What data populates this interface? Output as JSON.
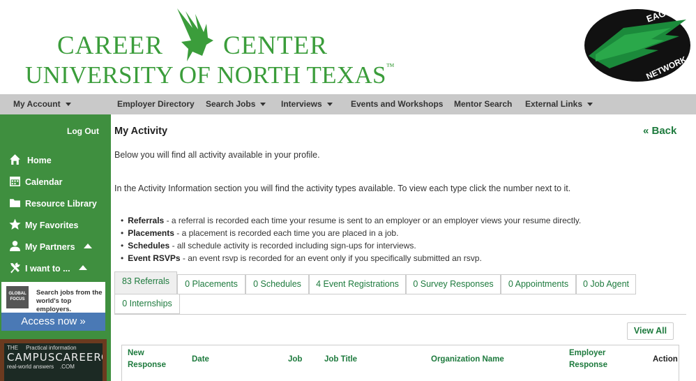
{
  "header": {
    "career_left": "CAREER",
    "career_right": "CENTER",
    "university": "UNIVERSITY OF NORTH TEXAS",
    "trademark": "™",
    "eagle_network_top": "EAGLE",
    "eagle_network_bottom": "NETWORK"
  },
  "topnav": {
    "items": [
      {
        "label": "My Account",
        "dropdown": true
      },
      {
        "label": "Employer Directory",
        "dropdown": false
      },
      {
        "label": "Search Jobs",
        "dropdown": true
      },
      {
        "label": "Interviews",
        "dropdown": true
      },
      {
        "label": "Events and Workshops",
        "dropdown": false
      },
      {
        "label": "Mentor Search",
        "dropdown": false
      },
      {
        "label": "External Links",
        "dropdown": true
      }
    ]
  },
  "sidebar": {
    "logout": "Log Out",
    "items": [
      {
        "label": "Home",
        "icon": "home-icon"
      },
      {
        "label": "Calendar",
        "icon": "calendar-icon"
      },
      {
        "label": "Resource Library",
        "icon": "folder-icon"
      },
      {
        "label": "My Favorites",
        "icon": "star-icon"
      },
      {
        "label": "My Partners",
        "icon": "user-icon"
      },
      {
        "label": "I want to ...",
        "icon": "tools-icon"
      }
    ],
    "ad_global": {
      "badge": "GLOBAL FOCUS",
      "text_line1": "Search jobs from the",
      "text_line2": "world's top employers.",
      "cta": "Access now »"
    },
    "ad_coach": {
      "line1": "THE",
      "line2": "Practical information",
      "line3": "CAMPUSCAREERCOACH",
      "line4": "real-world answers",
      "line5": ".COM"
    }
  },
  "main": {
    "title": "My Activity",
    "back": "« Back",
    "intro": "Below you will find all activity available in your profile.",
    "info": "In the Activity Information section you will find the activity types available. To view each type click the number next to it.",
    "bullets": [
      {
        "term": "Referrals",
        "desc": " - a referral is recorded each time your resume is sent to an employer or an employer views your resume directly."
      },
      {
        "term": "Placements",
        "desc": " - a placement is recorded each time you are placed in a job."
      },
      {
        "term": "Schedules",
        "desc": " - all schedule activity is recorded including sign-ups for interviews."
      },
      {
        "term": "Event RSVPs",
        "desc": " - an event rsvp is recorded for an event only if you specifically submitted an rsvp."
      }
    ],
    "tabs": [
      "83 Referrals",
      "0 Placements",
      "0 Schedules",
      "4 Event Registrations",
      "0 Survey Responses",
      "0 Appointments",
      "0 Job Agent",
      "0 Internships"
    ],
    "view_all": "View All",
    "table_headers": {
      "new_response_1": "New",
      "new_response_2": "Response",
      "date": "Date",
      "job": "Job",
      "job_title": "Job Title",
      "organization": "Organization Name",
      "employer_response_1": "Employer",
      "employer_response_2": "Response",
      "action": "Action"
    }
  },
  "colors": {
    "brand_green": "#3b9d3b",
    "sidebar_green": "#3f8f3f",
    "link_green": "#1d7a3d",
    "nav_gray": "#c9c9c9"
  }
}
